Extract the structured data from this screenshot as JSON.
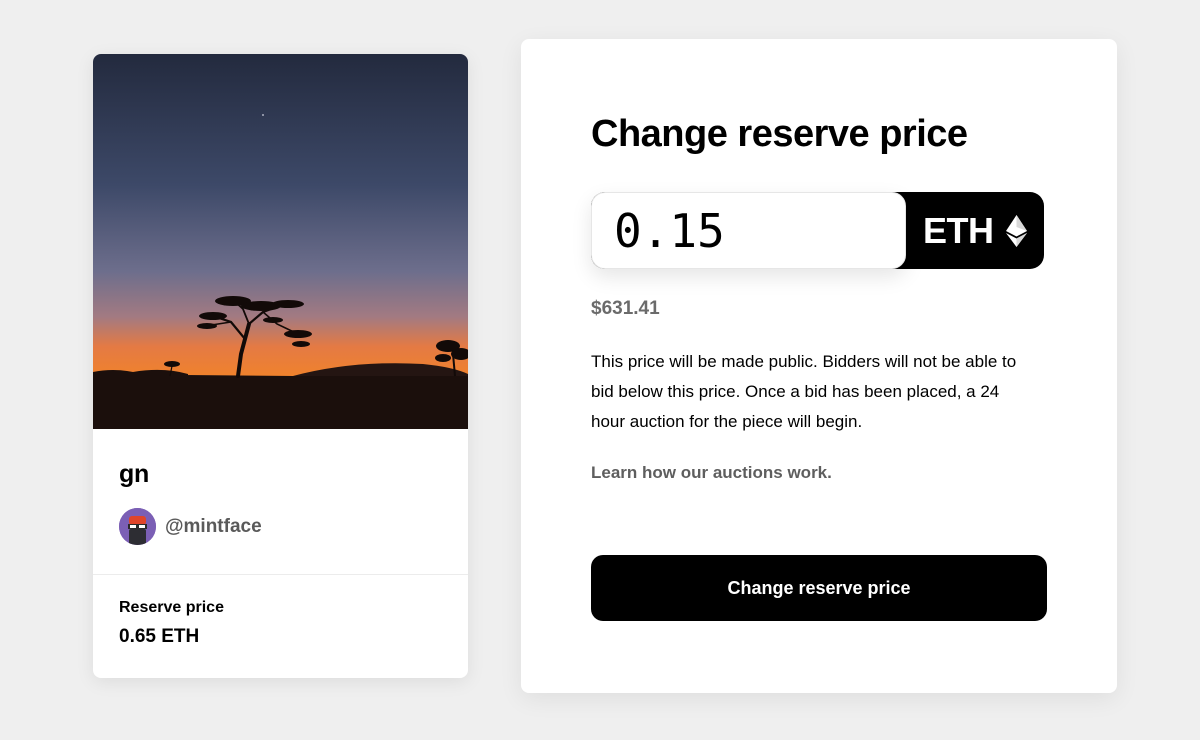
{
  "nft": {
    "title": "gn",
    "creator_handle": "@mintface",
    "reserve_label": "Reserve price",
    "reserve_value": "0.65 ETH",
    "image_subject": "sunset-savanna-acacia-tree"
  },
  "form": {
    "title": "Change reserve price",
    "price_value": "0.15",
    "currency": "ETH",
    "currency_icon": "ethereum-icon",
    "usd_value": "$631.41",
    "description": "This price will be made public. Bidders will not be able to bid below this price. Once a bid has been placed, a 24 hour auction for the piece will begin.",
    "learn_link": "Learn how our auctions work.",
    "submit_label": "Change reserve price"
  },
  "colors": {
    "background": "#efefef",
    "button": "#000000",
    "muted_text": "#6b6b6b"
  }
}
